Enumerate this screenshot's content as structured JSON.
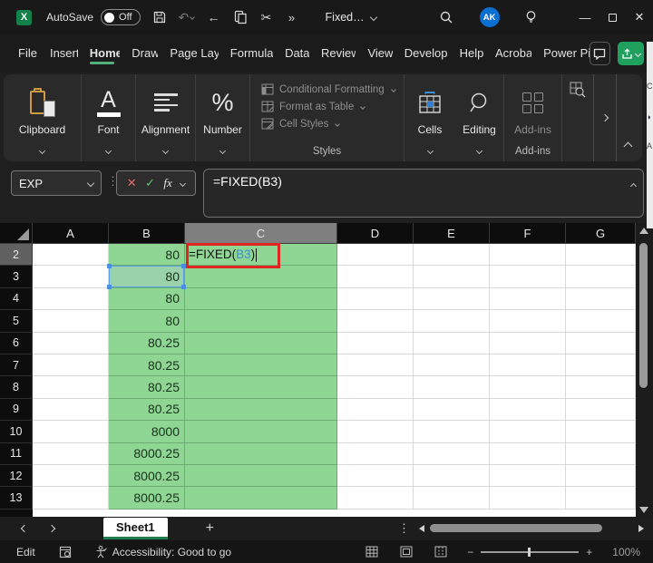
{
  "titlebar": {
    "autosave_label": "AutoSave",
    "autosave_state": "Off",
    "doc_title": "Fixed…",
    "avatar_initials": "AK"
  },
  "menubar": {
    "tabs": [
      "File",
      "Insert",
      "Home",
      "Draw",
      "Page Layo",
      "Formulas",
      "Data",
      "Review",
      "View",
      "Develope",
      "Help",
      "Acrobat",
      "Power Piv"
    ],
    "active_tab": "Home"
  },
  "ribbon": {
    "groups": [
      {
        "label": "Clipboard"
      },
      {
        "label": "Font"
      },
      {
        "label": "Alignment"
      },
      {
        "label": "Number"
      }
    ],
    "styles_items": [
      "Conditional Formatting",
      "Format as Table",
      "Cell Styles"
    ],
    "styles_group_label": "Styles",
    "cells_label": "Cells",
    "editing_label": "Editing",
    "addins_button_label": "Add-ins",
    "addins_group_label": "Add-ins"
  },
  "formula_bar": {
    "name_box_value": "EXP",
    "formula": "=FIXED(B3)"
  },
  "grid": {
    "column_headers": [
      "A",
      "B",
      "C",
      "D",
      "E",
      "F",
      "G"
    ],
    "active_column": "C",
    "active_row": "2",
    "active_cell_formula": {
      "pre": "=FIXED(",
      "ref": "B3",
      "post": ")"
    },
    "rows": [
      {
        "num": "2",
        "b": "80"
      },
      {
        "num": "3",
        "b": "80"
      },
      {
        "num": "4",
        "b": "80"
      },
      {
        "num": "5",
        "b": "80"
      },
      {
        "num": "6",
        "b": "80.25"
      },
      {
        "num": "7",
        "b": "80.25"
      },
      {
        "num": "8",
        "b": "80.25"
      },
      {
        "num": "9",
        "b": "80.25"
      },
      {
        "num": "10",
        "b": "8000"
      },
      {
        "num": "11",
        "b": "8000.25"
      },
      {
        "num": "12",
        "b": "8000.25"
      },
      {
        "num": "13",
        "b": "8000.25"
      }
    ]
  },
  "sheet_tabs": {
    "active_tab": "Sheet1"
  },
  "status_bar": {
    "mode": "Edit",
    "accessibility_text": "Accessibility: Good to go",
    "zoom_level": "100%"
  },
  "colors": {
    "cell_green": "#8fd694",
    "accent_green": "#1fa05e",
    "reference_blue": "#3f8fd4",
    "annotation_red": "#e02420"
  }
}
